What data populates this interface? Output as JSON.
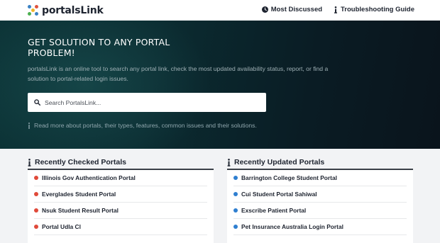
{
  "header": {
    "logo_text": "portalsLink",
    "nav": [
      {
        "label": "Most Discussed",
        "icon": "clock-icon"
      },
      {
        "label": "Troubleshooting Guide",
        "icon": "info-icon"
      }
    ]
  },
  "hero": {
    "title_line1": "GET SOLUTION TO ANY PORTAL",
    "title_line2": "PROBLEM!",
    "description": "portalsLink is an online tool to search any portal link, check the most updated availability status, report, or find a solution to portal-related login issues.",
    "search_placeholder": "Search PortalsLink...",
    "read_more": "Read more about portals, their types, features, common issues and their solutions."
  },
  "recent_checked": {
    "title": "Recently Checked Portals",
    "items": [
      "Illinois Gov Authentication Portal",
      "Everglades Student Portal",
      "Nsuk Student Result Portal",
      "Portal Udla Cl"
    ]
  },
  "recent_updated": {
    "title": "Recently Updated Portals",
    "items": [
      "Barrington College Student Portal",
      "Cui Student Portal Sahiwal",
      "Exscribe Patient Portal",
      "Pet Insurance Australia Login Portal"
    ]
  },
  "colors": {
    "logo_dots": [
      "#3b82c4",
      "#e0533d",
      "#f0b429",
      "#4caf50"
    ],
    "checked_dot": "#e04a3a",
    "updated_dot": "#2f7fd0"
  }
}
